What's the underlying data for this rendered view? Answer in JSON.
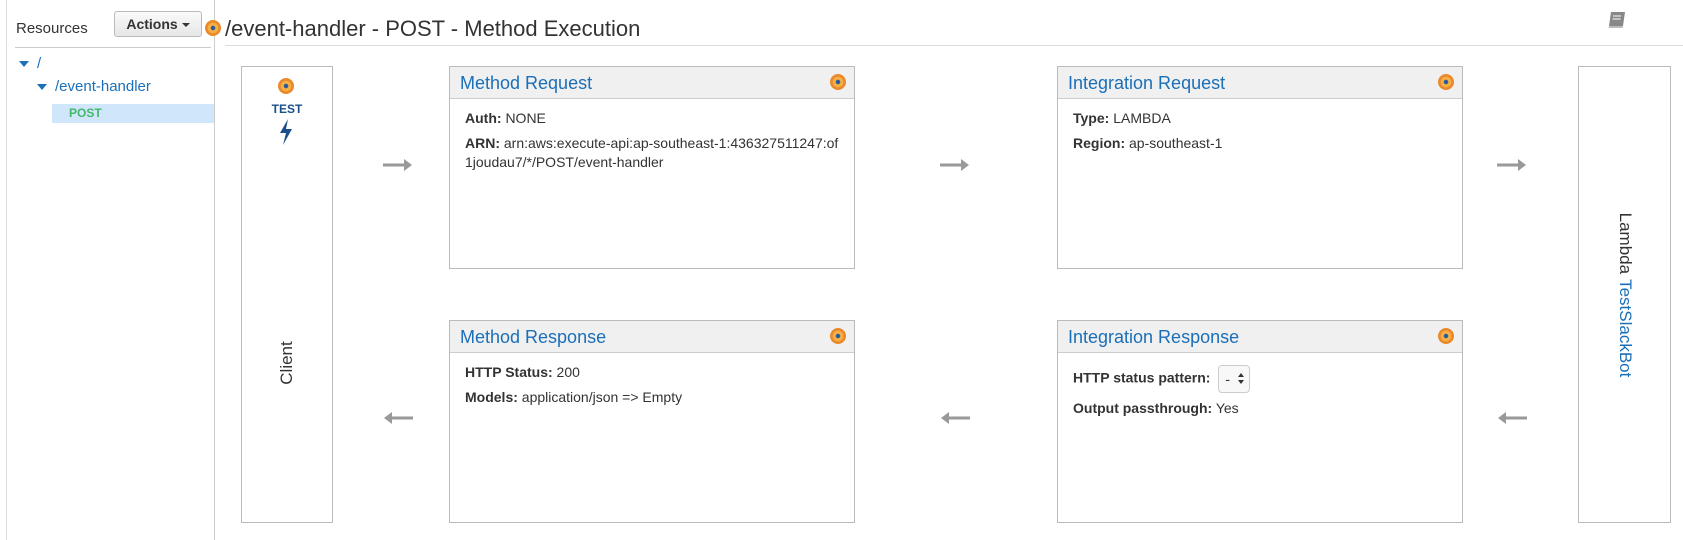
{
  "sidebar": {
    "resources_title": "Resources",
    "actions_label": "Actions",
    "tree": [
      {
        "label": "/",
        "expanded": true
      },
      {
        "label": "/event-handler",
        "expanded": true
      },
      {
        "label": "POST",
        "selected": true
      }
    ]
  },
  "header": {
    "title": "/event-handler - POST - Method Execution",
    "book_icon": "book-icon"
  },
  "client": {
    "test_label": "TEST",
    "label": "Client"
  },
  "lambda": {
    "label": "Lambda",
    "function_name": "TestSlackBot"
  },
  "method_request": {
    "title": "Method Request",
    "auth_label": "Auth:",
    "auth_value": "NONE",
    "arn_label": "ARN:",
    "arn_value": "arn:aws:execute-api:ap-southeast-1:436327511247:of1joudau7/*/POST/event-handler"
  },
  "integration_request": {
    "title": "Integration Request",
    "type_label": "Type:",
    "type_value": "LAMBDA",
    "region_label": "Region:",
    "region_value": "ap-southeast-1"
  },
  "method_response": {
    "title": "Method Response",
    "status_label": "HTTP Status:",
    "status_value": "200",
    "models_label": "Models:",
    "models_value": "application/json => Empty"
  },
  "integration_response": {
    "title": "Integration Response",
    "pattern_label": "HTTP status pattern:",
    "pattern_value": "-",
    "passthrough_label": "Output passthrough:",
    "passthrough_value": "Yes"
  },
  "colors": {
    "link": "#1a6fb8",
    "post": "#44b86a",
    "selected_bg": "#cfe6fb",
    "dot_orange": "#ea8a2c"
  }
}
